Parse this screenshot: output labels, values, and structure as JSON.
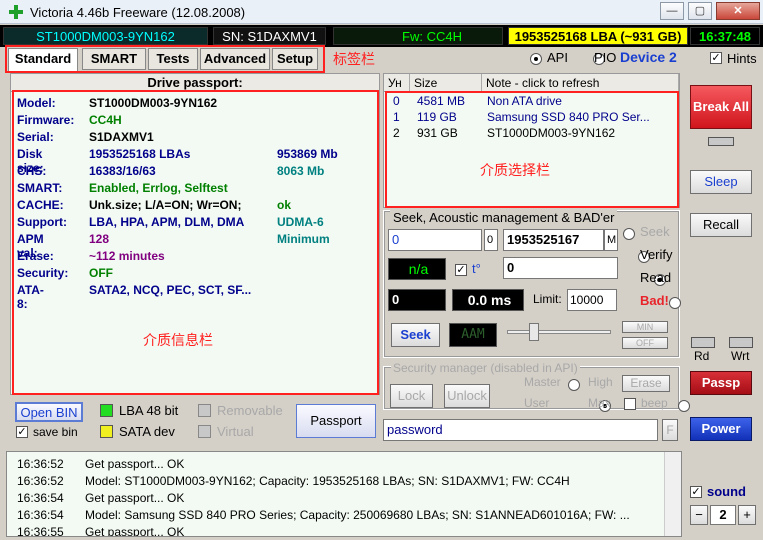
{
  "window": {
    "title": "Victoria 4.46b Freeware (12.08.2008)",
    "minimize_icon": "minimize-icon",
    "maximize_icon": "maximize-icon",
    "close_icon": "close-icon",
    "minimize_glyph": "—",
    "maximize_glyph": "▢",
    "close_glyph": "✕"
  },
  "infobar": {
    "model": "ST1000DM003-9YN162",
    "serial": "SN: S1DAXMV1",
    "firmware": "Fw: CC4H",
    "lba": "1953525168 LBA (~931 GB)",
    "clock": "16:37:48"
  },
  "tabs": [
    {
      "label": "Standard"
    },
    {
      "label": "SMART"
    },
    {
      "label": "Tests"
    },
    {
      "label": "Advanced"
    },
    {
      "label": "Setup"
    }
  ],
  "tabs_annotation": "标签栏",
  "mode": {
    "api_label": "API",
    "pio_label": "PIO",
    "device_label": "Device 2",
    "hints_label": "Hints",
    "hints_check": "✓"
  },
  "passport": {
    "header": "Drive passport:",
    "annotation": "介质信息栏",
    "rows": [
      {
        "label": "Model:",
        "value": "ST1000DM003-9YN162",
        "value_color": "#000000",
        "extra": "",
        "extra_color": "#000000"
      },
      {
        "label": "Firmware:",
        "value": "CC4H",
        "value_color": "#008000",
        "extra": "",
        "extra_color": "#000000"
      },
      {
        "label": "Serial:",
        "value": "S1DAXMV1",
        "value_color": "#000000",
        "extra": "",
        "extra_color": "#000000"
      },
      {
        "label": "Disk size:",
        "value": "1953525168 LBAs",
        "value_color": "#00008b",
        "extra": "953869 Mb",
        "extra_color": "#00008b"
      },
      {
        "label": "CHS:",
        "value": "16383/16/63",
        "value_color": "#00008b",
        "extra": "8063 Mb",
        "extra_color": "#008080"
      },
      {
        "label": "SMART:",
        "value": "Enabled, Errlog, Selftest",
        "value_color": "#008000",
        "extra": "",
        "extra_color": "#000000"
      },
      {
        "label": "CACHE:",
        "value": "Unk.size; L/A=ON; Wr=ON;",
        "value_color": "#000000",
        "extra": "ok",
        "extra_color": "#008000"
      },
      {
        "label": "Support:",
        "value": "LBA, HPA, APM, DLM, DMA",
        "value_color": "#00008b",
        "extra": "UDMA-6",
        "extra_color": "#008080"
      },
      {
        "label": "APM val:",
        "value": "128",
        "value_color": "#800080",
        "extra": "Minimum",
        "extra_color": "#008080"
      },
      {
        "label": "Erase:",
        "value": "~112 minutes",
        "value_color": "#800080",
        "extra": "",
        "extra_color": "#000000"
      },
      {
        "label": "Security:",
        "value": "OFF",
        "value_color": "#008000",
        "extra": "",
        "extra_color": "#000000"
      },
      {
        "label": "ATA-8:",
        "value": "SATA2, NCQ, PEC, SCT, SF...",
        "value_color": "#00008b",
        "extra": "",
        "extra_color": "#000000"
      }
    ]
  },
  "devices": {
    "headers": {
      "num": "Ун",
      "size": "Size",
      "note": "Note - click to refresh"
    },
    "annotation": "介质选择栏",
    "rows": [
      {
        "num": "0",
        "size": "4581 MB",
        "note": "Non ATA drive",
        "color": "#00008b"
      },
      {
        "num": "1",
        "size": "119 GB",
        "note": "Samsung SSD 840 PRO Ser...",
        "color": "#00008b"
      },
      {
        "num": "2",
        "size": "931 GB",
        "note": "ST1000DM003-9YN162",
        "color": "#000000"
      }
    ]
  },
  "seek": {
    "title": "Seek, Acoustic management & BAD'er",
    "start_value": "0",
    "start_suffix": "0",
    "end_value": "1953525167",
    "end_suffix": "M",
    "status": "n/a",
    "temp_label": "t°",
    "temp_check": "✓",
    "temp_value": "0",
    "position": "0",
    "time": "0.0 ms",
    "limit_label": "Limit:",
    "limit_value": "10000",
    "seek_button": "Seek",
    "aam_text": "AAM",
    "min_label": "MIN",
    "off_label": "OFF",
    "mode_seek": "Seek",
    "mode_verify": "Verify",
    "mode_read": "Read",
    "mode_bad": "Bad!"
  },
  "security": {
    "title": "Security manager (disabled in API)",
    "lock": "Lock",
    "unlock": "Unlock",
    "master": "Master",
    "high": "High",
    "erase": "Erase",
    "user": "User",
    "max": "Max",
    "beep": "beep",
    "password_placeholder": "password",
    "f_label": "F"
  },
  "bottom_left": {
    "open_bin": "Open BIN",
    "save_bin": "save bin",
    "save_check": "✓",
    "lba48": "LBA 48 bit",
    "satadev": "SATA dev",
    "removable": "Removable",
    "virtual": "Virtual",
    "passport_button": "Passport"
  },
  "right": {
    "break_all": "Break All",
    "sleep": "Sleep",
    "recall": "Recall",
    "rd": "Rd",
    "wrt": "Wrt",
    "passp": "Passp",
    "power": "Power",
    "sound": "sound",
    "sound_check": "✓",
    "spin_value": "2",
    "spin_minus": "−",
    "spin_plus": "+"
  },
  "log": [
    {
      "time": "16:36:52",
      "msg": "Get passport... OK"
    },
    {
      "time": "16:36:52",
      "msg": "Model: ST1000DM003-9YN162; Capacity: 1953525168 LBAs; SN: S1DAXMV1; FW: CC4H"
    },
    {
      "time": "16:36:54",
      "msg": "Get passport... OK"
    },
    {
      "time": "16:36:54",
      "msg": "Model: Samsung SSD 840 PRO Series; Capacity: 250069680 LBAs; SN: S1ANNEAD601016A; FW: ..."
    },
    {
      "time": "16:36:55",
      "msg": "Get passport... OK"
    }
  ],
  "colors": {
    "annotation_red": "#ff2020",
    "break_all_bg": "#e8232a",
    "passp_bg": "#c0101a",
    "power_bg": "#1a3fd0"
  }
}
